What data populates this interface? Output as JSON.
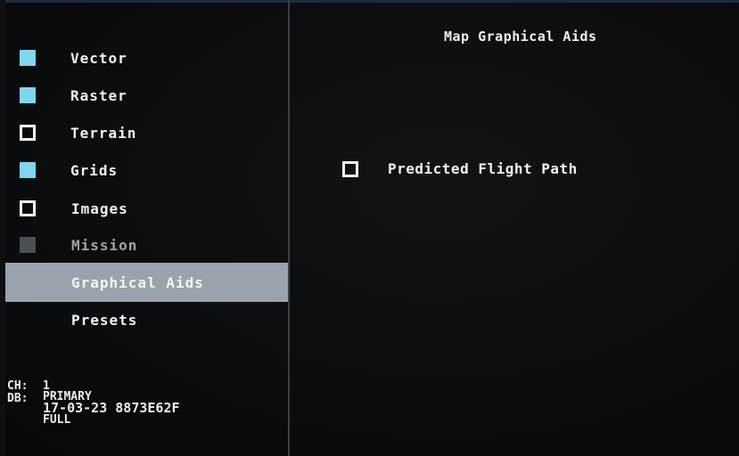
{
  "menu": {
    "items": [
      {
        "label": "Vector",
        "state": "checked"
      },
      {
        "label": "Raster",
        "state": "checked"
      },
      {
        "label": "Terrain",
        "state": "unchecked"
      },
      {
        "label": "Grids",
        "state": "checked"
      },
      {
        "label": "Images",
        "state": "unchecked"
      },
      {
        "label": "Mission",
        "state": "disabled"
      },
      {
        "label": "Graphical Aids",
        "state": "selected"
      },
      {
        "label": "Presets",
        "state": "none"
      }
    ]
  },
  "panel": {
    "title": "Map Graphical Aids",
    "options": [
      {
        "label": "Predicted Flight Path",
        "checked": false
      }
    ]
  },
  "status": {
    "ch_label": "CH:",
    "ch_value": "1",
    "db_label": "DB:",
    "db_value": "PRIMARY",
    "db_date_id": "17-03-23 8873E62F",
    "db_mode": "FULL"
  },
  "colors": {
    "checked": "#7fd6ef",
    "selected_bg": "#9aa3ad",
    "background": "#0b0c0e"
  }
}
